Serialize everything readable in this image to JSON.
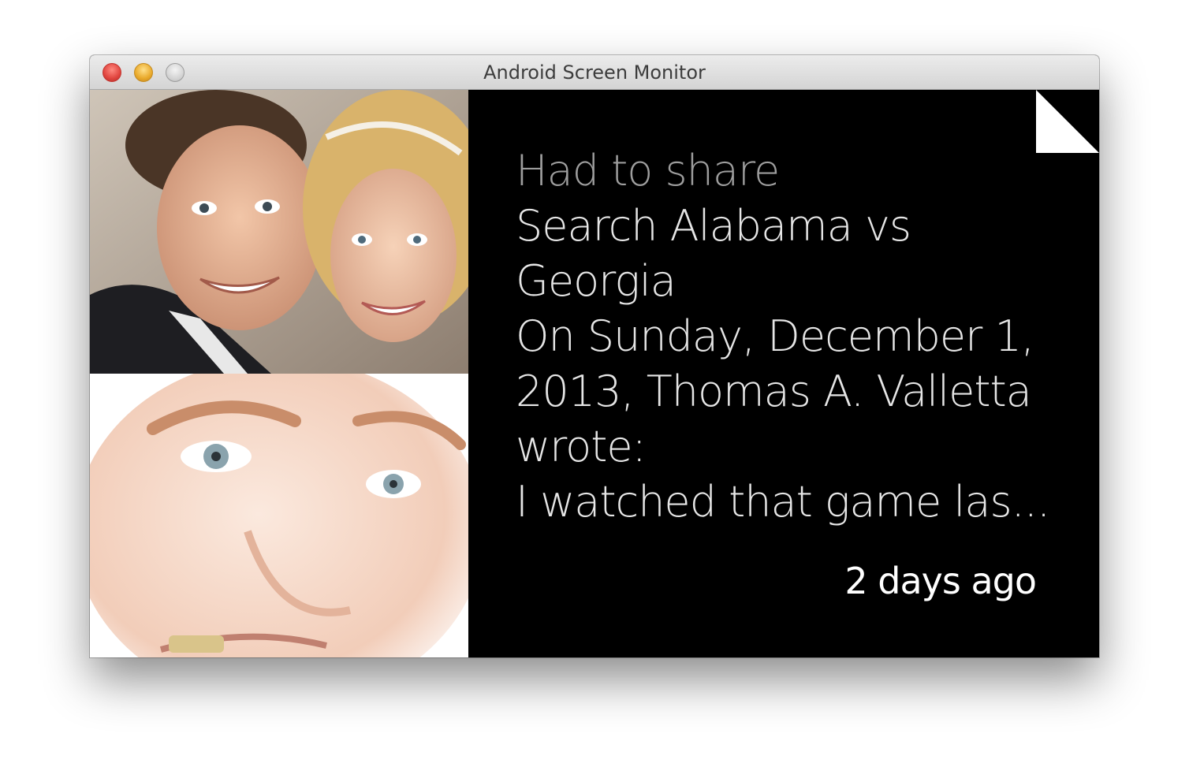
{
  "window": {
    "title": "Android Screen Monitor"
  },
  "card": {
    "heading": "Had to share",
    "lines": [
      "Search Alabama vs",
      "Georgia",
      "On Sunday, December 1,",
      "2013, Thomas A. Valletta",
      "wrote:",
      "I watched that game las..."
    ],
    "timestamp": "2 days ago"
  },
  "images": {
    "top": "photo-couple",
    "bottom": "photo-face-closeup"
  },
  "colors": {
    "card_background": "#000000",
    "heading_text": "#9e9e9e",
    "body_text": "#e6e6e6",
    "timestamp_text": "#ffffff"
  }
}
